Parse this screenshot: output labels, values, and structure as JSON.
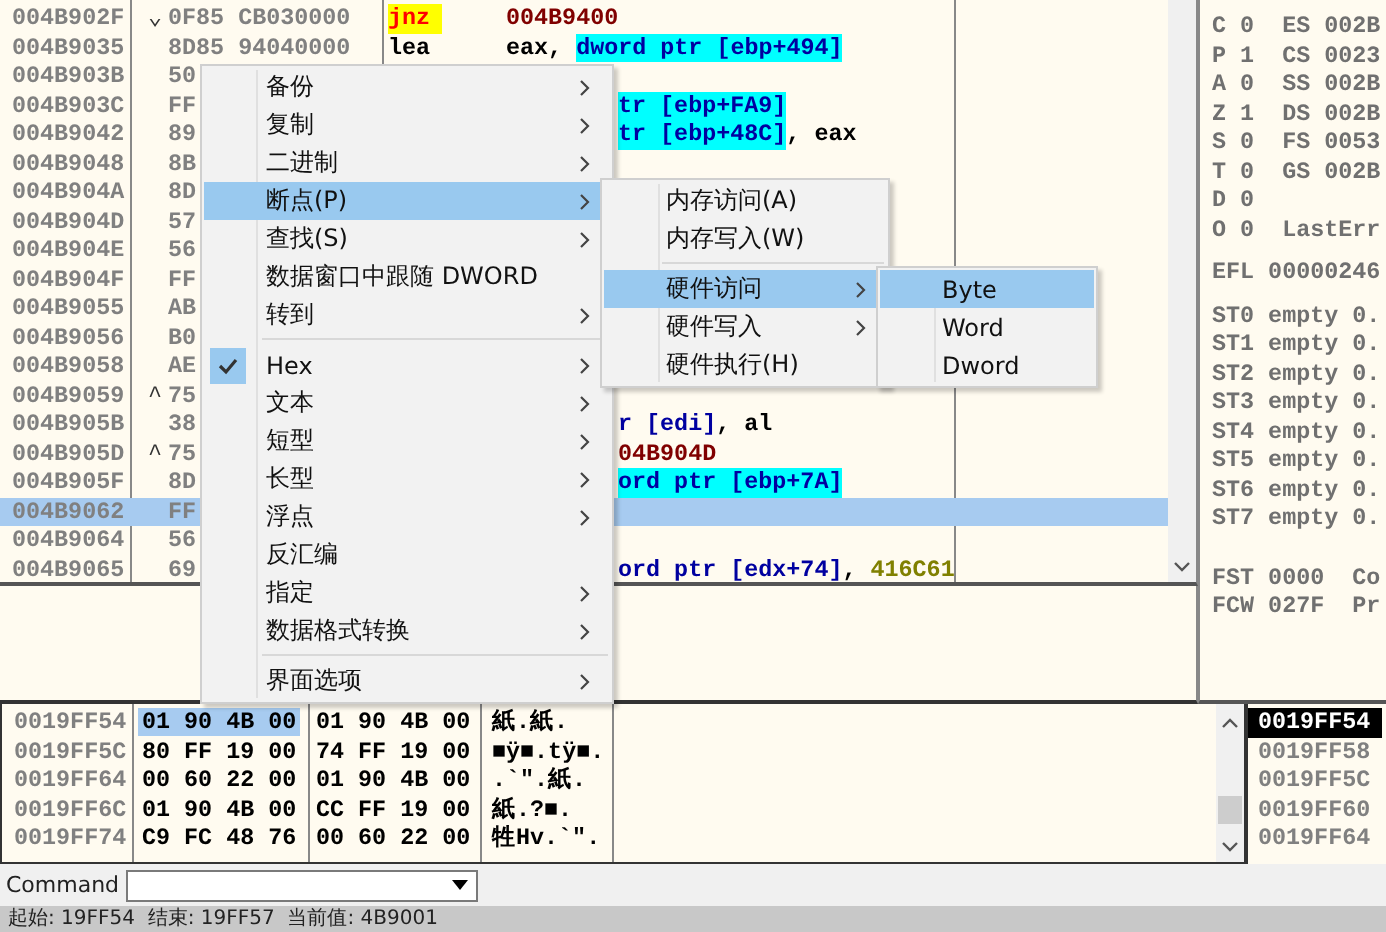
{
  "disassembly": {
    "rows": [
      {
        "address": "004B902F",
        "jump": "⌄",
        "bytes": "0F85 CB030000",
        "selected": false,
        "segments": [
          {
            "kind": "jump_mnemonic",
            "text": "jnz"
          },
          {
            "kind": "address",
            "text": "004B9400"
          }
        ]
      },
      {
        "address": "004B9035",
        "bytes": "8D85 94040000",
        "selected": false,
        "segments": [
          {
            "kind": "mnemonic",
            "text": "lea"
          },
          {
            "kind": "plain",
            "text": "eax,"
          },
          {
            "kind": "mem",
            "text": "dword ptr [ebp+494]"
          }
        ]
      },
      {
        "address": "004B903B",
        "bytes": "50",
        "selected": false,
        "segments": []
      },
      {
        "address": "004B903C",
        "bytes": "FF",
        "selected": false,
        "segments": [
          {
            "kind": "mem",
            "text": "tr [ebp+FA9]"
          }
        ]
      },
      {
        "address": "004B9042",
        "bytes": "89",
        "selected": false,
        "segments": [
          {
            "kind": "mem",
            "text": "tr [ebp+48C]"
          },
          {
            "kind": "plain",
            "text": ", eax"
          }
        ]
      },
      {
        "address": "004B9048",
        "bytes": "8B",
        "selected": false,
        "segments": []
      },
      {
        "address": "004B904A",
        "bytes": "8D",
        "selected": false,
        "segments": []
      },
      {
        "address": "004B904D",
        "bytes": "57",
        "selected": false,
        "segments": []
      },
      {
        "address": "004B904E",
        "bytes": "56",
        "selected": false,
        "segments": []
      },
      {
        "address": "004B904F",
        "bytes": "FF",
        "selected": false,
        "segments": []
      },
      {
        "address": "004B9055",
        "bytes": "AB",
        "selected": false,
        "segments": []
      },
      {
        "address": "004B9056",
        "bytes": "B0",
        "selected": false,
        "segments": []
      },
      {
        "address": "004B9058",
        "bytes": "AE",
        "selected": false,
        "segments": []
      },
      {
        "address": "004B9059",
        "jump": "^",
        "bytes": "75",
        "selected": false,
        "segments": []
      },
      {
        "address": "004B905B",
        "bytes": "38",
        "selected": false,
        "segments": [
          {
            "kind": "memref",
            "text": "r [edi]"
          },
          {
            "kind": "plain",
            "text": ", al"
          }
        ]
      },
      {
        "address": "004B905D",
        "jump": "^",
        "bytes": "75",
        "selected": false,
        "segments": [
          {
            "kind": "address",
            "text": "04B904D"
          }
        ]
      },
      {
        "address": "004B905F",
        "bytes": "8D",
        "selected": false,
        "segments": [
          {
            "kind": "mem",
            "text": "ord ptr [ebp+7A]"
          }
        ]
      },
      {
        "address": "004B9062",
        "bytes": "FF",
        "selected": true,
        "segments": []
      },
      {
        "address": "004B9064",
        "bytes": "56",
        "selected": false,
        "segments": []
      },
      {
        "address": "004B9065",
        "bytes": "69",
        "selected": false,
        "segments": [
          {
            "kind": "memref",
            "text": "ord ptr [edx+74]"
          },
          {
            "kind": "plain",
            "text": ", "
          },
          {
            "kind": "const",
            "text": "416C61"
          }
        ]
      }
    ]
  },
  "registers": {
    "flags": [
      "C 0  ES 002B",
      "P 1  CS 0023",
      "A 0  SS 002B",
      "Z 1  DS 002B",
      "S 0  FS 0053",
      "T 0  GS 002B",
      "D 0",
      "O 0  LastErr"
    ],
    "efl": "EFL 00000246",
    "fpu": [
      "ST0 empty 0.",
      "ST1 empty 0.",
      "ST2 empty 0.",
      "ST3 empty 0.",
      "ST4 empty 0.",
      "ST5 empty 0.",
      "ST6 empty 0.",
      "ST7 empty 0."
    ],
    "status": [
      "FST 0000  Co",
      "FCW 027F  Pr"
    ]
  },
  "dump": {
    "rows": [
      {
        "address": "0019FF54",
        "hex_1": "01 90 4B 00",
        "hex_2": "01 90 4B 00",
        "ascii": "紙.紙.",
        "selected": true
      },
      {
        "address": "0019FF5C",
        "hex_1": "80 FF 19 00",
        "hex_2": "74 FF 19 00",
        "ascii": "■ÿ■.tÿ■.",
        "selected": false
      },
      {
        "address": "0019FF64",
        "hex_1": "00 60 22 00",
        "hex_2": "01 90 4B 00",
        "ascii": ".`\".紙.",
        "selected": false
      },
      {
        "address": "0019FF6C",
        "hex_1": "01 90 4B 00",
        "hex_2": "CC FF 19 00",
        "ascii": "紙.?■.",
        "selected": false
      },
      {
        "address": "0019FF74",
        "hex_1": "C9 FC 48 76",
        "hex_2": "00 60 22 00",
        "ascii": "牲Hv.`\".",
        "selected": false
      }
    ]
  },
  "stack": {
    "rows": [
      {
        "address": "0019FF54",
        "selected": true
      },
      {
        "address": "0019FF58",
        "selected": false
      },
      {
        "address": "0019FF5C",
        "selected": false
      },
      {
        "address": "0019FF60",
        "selected": false
      },
      {
        "address": "0019FF64",
        "selected": false
      }
    ]
  },
  "command": {
    "label": "Command"
  },
  "status_bar": "起始: 19FF54  结束: 19FF57  当前值: 4B9001",
  "context_menu": {
    "items": [
      {
        "kind": "item",
        "label": "备份",
        "submenu": true,
        "selected": false,
        "checked": false
      },
      {
        "kind": "item",
        "label": "复制",
        "submenu": true,
        "selected": false,
        "checked": false
      },
      {
        "kind": "item",
        "label": "二进制",
        "submenu": true,
        "selected": false,
        "checked": false
      },
      {
        "kind": "item",
        "label": "断点(P)",
        "submenu": true,
        "selected": true,
        "checked": false,
        "children": [
          {
            "kind": "item",
            "label": "内存访问(A)",
            "submenu": false,
            "selected": false
          },
          {
            "kind": "item",
            "label": "内存写入(W)",
            "submenu": false,
            "selected": false
          },
          {
            "kind": "separator"
          },
          {
            "kind": "item",
            "label": "硬件访问",
            "submenu": true,
            "selected": true,
            "children": [
              {
                "kind": "item",
                "label": "Byte",
                "submenu": false,
                "selected": true
              },
              {
                "kind": "item",
                "label": "Word",
                "submenu": false,
                "selected": false
              },
              {
                "kind": "item",
                "label": "Dword",
                "submenu": false,
                "selected": false
              }
            ]
          },
          {
            "kind": "item",
            "label": "硬件写入",
            "submenu": true,
            "selected": false
          },
          {
            "kind": "item",
            "label": "硬件执行(H)",
            "submenu": false,
            "selected": false
          }
        ]
      },
      {
        "kind": "item",
        "label": "查找(S)",
        "submenu": true,
        "selected": false,
        "checked": false
      },
      {
        "kind": "item",
        "label": "数据窗口中跟随 DWORD",
        "submenu": false,
        "selected": false,
        "checked": false
      },
      {
        "kind": "item",
        "label": "转到",
        "submenu": true,
        "selected": false,
        "checked": false
      },
      {
        "kind": "separator"
      },
      {
        "kind": "item",
        "label": "Hex",
        "submenu": true,
        "selected": false,
        "checked": true
      },
      {
        "kind": "item",
        "label": "文本",
        "submenu": true,
        "selected": false,
        "checked": false
      },
      {
        "kind": "item",
        "label": "短型",
        "submenu": true,
        "selected": false,
        "checked": false
      },
      {
        "kind": "item",
        "label": "长型",
        "submenu": true,
        "selected": false,
        "checked": false
      },
      {
        "kind": "item",
        "label": "浮点",
        "submenu": true,
        "selected": false,
        "checked": false
      },
      {
        "kind": "item",
        "label": "反汇编",
        "submenu": false,
        "selected": false,
        "checked": false
      },
      {
        "kind": "item",
        "label": "指定",
        "submenu": true,
        "selected": false,
        "checked": false
      },
      {
        "kind": "item",
        "label": "数据格式转换",
        "submenu": true,
        "selected": false,
        "checked": false
      },
      {
        "kind": "separator"
      },
      {
        "kind": "item",
        "label": "界面选项",
        "submenu": true,
        "selected": false,
        "checked": false
      }
    ]
  }
}
